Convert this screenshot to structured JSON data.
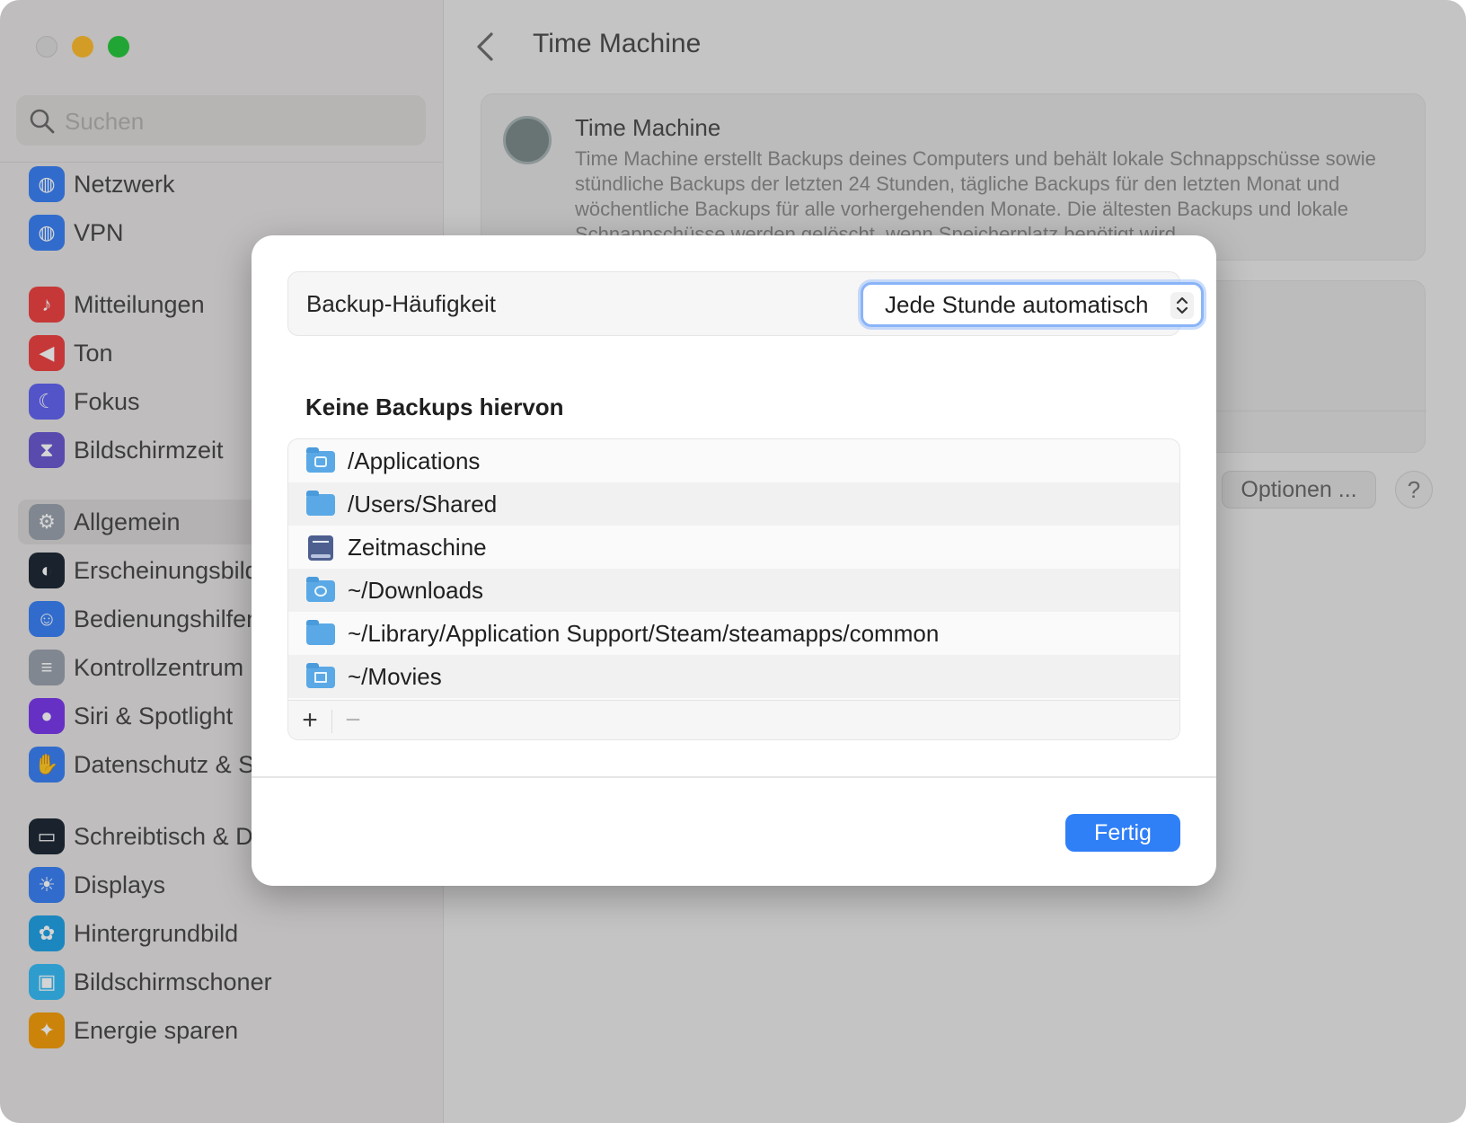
{
  "sidebar": {
    "search_placeholder": "Suchen",
    "items": [
      {
        "label": "Netzwerk",
        "icon": "globe-icon",
        "color": "#3b82f6"
      },
      {
        "label": "VPN",
        "icon": "globe-icon",
        "color": "#3b82f6"
      },
      {
        "label": "Mitteilungen",
        "icon": "bell-icon",
        "color": "#ef4444"
      },
      {
        "label": "Ton",
        "icon": "speaker-icon",
        "color": "#ef4444"
      },
      {
        "label": "Fokus",
        "icon": "moon-icon",
        "color": "#6366f1"
      },
      {
        "label": "Bildschirmzeit",
        "icon": "hourglass-icon",
        "color": "#6b5bd2"
      },
      {
        "label": "Allgemein",
        "icon": "gear-icon",
        "color": "#9ca3af"
      },
      {
        "label": "Erscheinungsbild",
        "icon": "appearance-icon",
        "color": "#1f2937"
      },
      {
        "label": "Bedienungshilfen",
        "icon": "accessibility-icon",
        "color": "#3b82f6"
      },
      {
        "label": "Kontrollzentrum",
        "icon": "toggles-icon",
        "color": "#9ca3af"
      },
      {
        "label": "Siri & Spotlight",
        "icon": "siri-icon",
        "color": "#7c3aed"
      },
      {
        "label": "Datenschutz & Sicherheit",
        "icon": "hand-icon",
        "color": "#3b82f6"
      },
      {
        "label": "Schreibtisch & Dock",
        "icon": "dock-icon",
        "color": "#1f2937"
      },
      {
        "label": "Displays",
        "icon": "sun-icon",
        "color": "#3b82f6"
      },
      {
        "label": "Hintergrundbild",
        "icon": "flower-icon",
        "color": "#22a3e6"
      },
      {
        "label": "Bildschirmschoner",
        "icon": "screensaver-icon",
        "color": "#38bdf8"
      },
      {
        "label": "Energie sparen",
        "icon": "bulb-icon",
        "color": "#f59e0b"
      }
    ]
  },
  "main": {
    "title": "Time Machine",
    "card": {
      "title": "Time Machine",
      "description": "Time Machine erstellt Backups deines Computers und behält lokale Schnappschüsse sowie stündliche Backups der letzten 24 Stunden, tägliche Backups für den letzten Monat und wöchentliche Backups für alle vorhergehenden Monate. Die ältesten Backups und lokale Schnappschüsse werden gelöscht, wenn Speicherplatz benötigt wird."
    },
    "options_label": "Optionen ...",
    "help_label": "?"
  },
  "sheet": {
    "frequency_label": "Backup-Häufigkeit",
    "frequency_value": "Jede Stunde automatisch",
    "exclusions_heading": "Keine Backups hiervon",
    "exclusions": [
      {
        "path": "/Applications",
        "icon": "applications-folder-icon"
      },
      {
        "path": "/Users/Shared",
        "icon": "folder-icon"
      },
      {
        "path": "Zeitmaschine",
        "icon": "disk-icon"
      },
      {
        "path": "~/Downloads",
        "icon": "downloads-folder-icon"
      },
      {
        "path": "~/Library/Application Support/Steam/steamapps/common",
        "icon": "folder-icon"
      },
      {
        "path": "~/Movies",
        "icon": "movies-folder-icon"
      }
    ],
    "add_label": "+",
    "remove_label": "−",
    "done_label": "Fertig"
  },
  "colors": {
    "accent": "#2f7ff7",
    "focus_ring": "#8ab4f8"
  }
}
